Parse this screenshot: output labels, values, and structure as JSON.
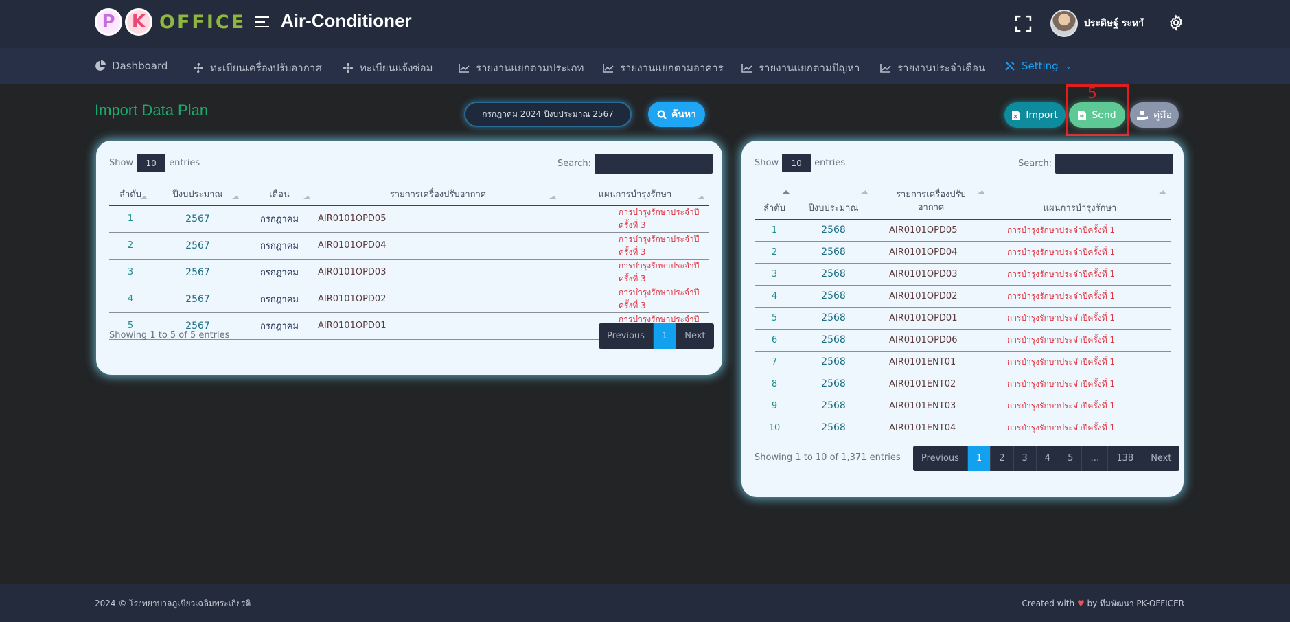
{
  "header": {
    "logo_text": "OFFICE",
    "logo_p": "P",
    "logo_k": "K",
    "app_title": "Air-Conditioner",
    "user_name": "ประดิษฐ์ ระหา"
  },
  "nav": {
    "items": [
      {
        "label": "Dashboard"
      },
      {
        "label": "ทะเบียนเครื่องปรับอากาศ"
      },
      {
        "label": "ทะเบียนแจ้งซ่อม"
      },
      {
        "label": "รายงานแยกตามประเภท"
      },
      {
        "label": "รายงานแยกตามอาคาร"
      },
      {
        "label": "รายงานแยกตามปัญหา"
      },
      {
        "label": "รายงานประจำเดือน"
      },
      {
        "label": "Setting"
      }
    ]
  },
  "page": {
    "title": "Import Data Plan",
    "filter_value": "กรกฎาคม 2024 ปีงบประมาณ 2567",
    "search_label": "ค้นหา",
    "import_label": "Import",
    "send_label": "Send",
    "manual_label": "คู่มือ",
    "annotation_number": "5"
  },
  "left_table": {
    "show_label": "Show",
    "entries_label": "entries",
    "length_value": "10",
    "search_label": "Search:",
    "columns": [
      "ลำดับ",
      "ปีงบประมาณ",
      "เดือน",
      "รายการเครื่องปรับอากาศ",
      "แผนการบำรุงรักษา"
    ],
    "rows": [
      [
        "1",
        "2567",
        "กรกฎาคม",
        "AIR0101OPD05",
        "การบำรุงรักษาประจำปีครั้งที่ 3"
      ],
      [
        "2",
        "2567",
        "กรกฎาคม",
        "AIR0101OPD04",
        "การบำรุงรักษาประจำปีครั้งที่ 3"
      ],
      [
        "3",
        "2567",
        "กรกฎาคม",
        "AIR0101OPD03",
        "การบำรุงรักษาประจำปีครั้งที่ 3"
      ],
      [
        "4",
        "2567",
        "กรกฎาคม",
        "AIR0101OPD02",
        "การบำรุงรักษาประจำปีครั้งที่ 3"
      ],
      [
        "5",
        "2567",
        "กรกฎาคม",
        "AIR0101OPD01",
        "การบำรุงรักษาประจำปีครั้งที่ 3"
      ]
    ],
    "info": "Showing 1 to 5 of 5 entries",
    "pagination": [
      "Previous",
      "1",
      "Next"
    ],
    "current_page": "1"
  },
  "right_table": {
    "show_label": "Show",
    "entries_label": "entries",
    "length_value": "10",
    "search_label": "Search:",
    "columns": [
      "ลำดับ",
      "ปีงบประมาณ",
      "รายการเครื่องปรับอากาศ",
      "แผนการบำรุงรักษา"
    ],
    "rows": [
      [
        "1",
        "2568",
        "AIR0101OPD05",
        "การบำรุงรักษาประจำปีครั้งที่ 1"
      ],
      [
        "2",
        "2568",
        "AIR0101OPD04",
        "การบำรุงรักษาประจำปีครั้งที่ 1"
      ],
      [
        "3",
        "2568",
        "AIR0101OPD03",
        "การบำรุงรักษาประจำปีครั้งที่ 1"
      ],
      [
        "4",
        "2568",
        "AIR0101OPD02",
        "การบำรุงรักษาประจำปีครั้งที่ 1"
      ],
      [
        "5",
        "2568",
        "AIR0101OPD01",
        "การบำรุงรักษาประจำปีครั้งที่ 1"
      ],
      [
        "6",
        "2568",
        "AIR0101OPD06",
        "การบำรุงรักษาประจำปีครั้งที่ 1"
      ],
      [
        "7",
        "2568",
        "AIR0101ENT01",
        "การบำรุงรักษาประจำปีครั้งที่ 1"
      ],
      [
        "8",
        "2568",
        "AIR0101ENT02",
        "การบำรุงรักษาประจำปีครั้งที่ 1"
      ],
      [
        "9",
        "2568",
        "AIR0101ENT03",
        "การบำรุงรักษาประจำปีครั้งที่ 1"
      ],
      [
        "10",
        "2568",
        "AIR0101ENT04",
        "การบำรุงรักษาประจำปีครั้งที่ 1"
      ]
    ],
    "info": "Showing 1 to 10 of 1,371 entries",
    "pagination": [
      "Previous",
      "1",
      "2",
      "3",
      "4",
      "5",
      "…",
      "138",
      "Next"
    ],
    "current_page": "1"
  },
  "footer": {
    "left": "2024 © โรงพยาบาลภูเขียวเฉลิมพระเกียรติ",
    "right_prefix": "Created with",
    "right_suffix": "by ทีมพัฒนา PK-OFFICER"
  },
  "colors": {
    "accent_blue": "#1ea5f3",
    "title_green": "#1ea96b",
    "plan_red": "#e0323d",
    "annotation_red": "#e11d1d"
  },
  "icons": [
    "menu-icon",
    "fullscreen-icon",
    "gear-icon",
    "pie-chart-icon",
    "fan-icon",
    "chart-line-icon",
    "tools-icon",
    "search-icon",
    "excel-icon",
    "file-send-icon",
    "hand-holding-icon",
    "heart-icon"
  ]
}
